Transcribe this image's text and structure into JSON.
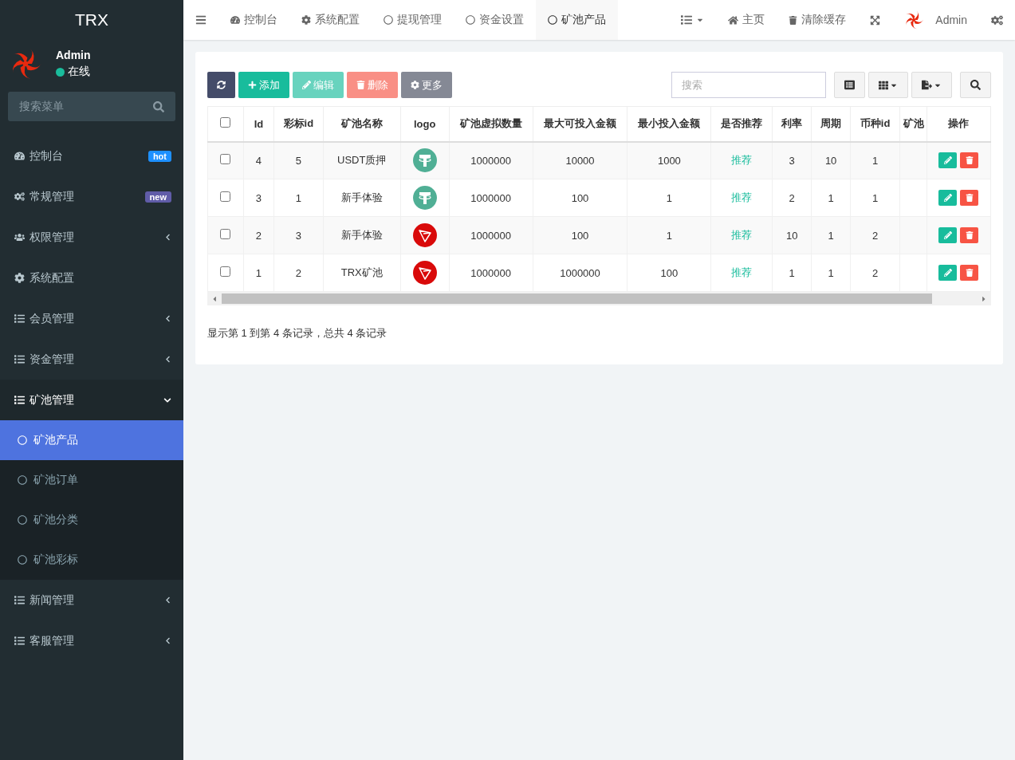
{
  "sidebar": {
    "brand": "TRX",
    "user": {
      "name": "Admin",
      "status": "在线"
    },
    "search": {
      "placeholder": "搜索菜单"
    },
    "items": [
      {
        "label": "控制台",
        "badge": {
          "text": "hot",
          "color": "#1e90ff"
        }
      },
      {
        "label": "常规管理",
        "badge": {
          "text": "new",
          "color": "#605ca8"
        }
      },
      {
        "label": "权限管理",
        "expanded": false
      },
      {
        "label": "系统配置"
      },
      {
        "label": "会员管理",
        "expanded": false
      },
      {
        "label": "资金管理",
        "expanded": false
      },
      {
        "label": "矿池管理",
        "expanded": true,
        "children": [
          {
            "label": "矿池产品",
            "selected": true
          },
          {
            "label": "矿池订单",
            "selected": false
          },
          {
            "label": "矿池分类",
            "selected": false
          },
          {
            "label": "矿池彩标",
            "selected": false
          }
        ]
      },
      {
        "label": "新闻管理",
        "expanded": false
      },
      {
        "label": "客服管理",
        "expanded": false
      }
    ]
  },
  "topbar": {
    "tabs": [
      {
        "label": "控制台",
        "selected": false
      },
      {
        "label": "系统配置",
        "selected": false
      },
      {
        "label": "提现管理",
        "selected": false
      },
      {
        "label": "资金设置",
        "selected": false
      },
      {
        "label": "矿池产品",
        "selected": true
      }
    ],
    "links": [
      "主页",
      "清除缓存"
    ],
    "user": "Admin"
  },
  "toolbar": {
    "buttons": [
      {
        "label": "添加",
        "disabled": false
      },
      {
        "label": "编辑",
        "disabled": true
      },
      {
        "label": "删除",
        "disabled": true
      },
      {
        "label": "更多",
        "disabled": false
      }
    ],
    "search": {
      "placeholder": "搜索"
    }
  },
  "table": {
    "header_checked": false,
    "columns": [
      "Id",
      "彩标id",
      "矿池名称",
      "logo",
      "矿池虚拟数量",
      "最大可投入金额",
      "最小投入金额",
      "是否推荐",
      "利率",
      "周期",
      "币种id",
      "矿池",
      "操作"
    ],
    "rows": [
      {
        "checked": false,
        "kind": "usdt",
        "cells": [
          "4",
          "5",
          "USDT质押",
          "",
          "1000000",
          "10000",
          "1000",
          "推荐",
          "3",
          "10",
          "1",
          ""
        ]
      },
      {
        "checked": false,
        "kind": "usdt",
        "cells": [
          "3",
          "1",
          "新手体验",
          "",
          "1000000",
          "100",
          "1",
          "推荐",
          "2",
          "1",
          "1",
          ""
        ]
      },
      {
        "checked": false,
        "kind": "trx",
        "cells": [
          "2",
          "3",
          "新手体验",
          "",
          "1000000",
          "100",
          "1",
          "推荐",
          "10",
          "1",
          "2",
          ""
        ]
      },
      {
        "checked": false,
        "kind": "trx",
        "cells": [
          "1",
          "2",
          "TRX矿池",
          "",
          "1000000",
          "1000000",
          "100",
          "推荐",
          "1",
          "1",
          "2",
          ""
        ]
      }
    ]
  },
  "footer": "显示第 1 到第 4 条记录，总共 4 条记录"
}
